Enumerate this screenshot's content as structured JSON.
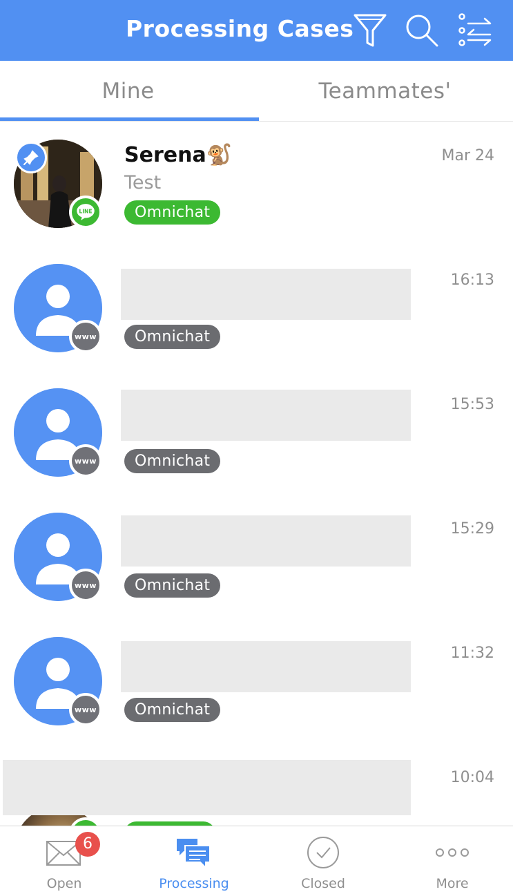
{
  "header": {
    "title": "Processing Cases",
    "icons": [
      "filter-icon",
      "search-icon",
      "sort-icon"
    ],
    "background": "#5190f2"
  },
  "tabs": [
    {
      "label": "Mine",
      "active": true
    },
    {
      "label": "Teammates'",
      "active": false
    }
  ],
  "conversations": [
    {
      "name": "Serena🐒",
      "preview": "Test",
      "time": "Mar 24",
      "tag": "Omnichat",
      "tag_color": "#3cb932",
      "channel": "LINE",
      "pinned": true,
      "avatar": "photo"
    },
    {
      "name": "",
      "preview": "",
      "time": "16:13",
      "tag": "Omnichat",
      "tag_color": "#6b6c70",
      "channel": "www",
      "pinned": false,
      "avatar": "default"
    },
    {
      "name": "",
      "preview": "",
      "time": "15:53",
      "tag": "Omnichat",
      "tag_color": "#6b6c70",
      "channel": "www",
      "pinned": false,
      "avatar": "default"
    },
    {
      "name": "",
      "preview": "",
      "time": "15:29",
      "tag": "Omnichat",
      "tag_color": "#6b6c70",
      "channel": "www",
      "pinned": false,
      "avatar": "default"
    },
    {
      "name": "",
      "preview": "",
      "time": "11:32",
      "tag": "Omnichat",
      "tag_color": "#6b6c70",
      "channel": "www",
      "pinned": false,
      "avatar": "default"
    },
    {
      "name": "",
      "preview": "",
      "time": "10:04",
      "tag": "",
      "tag_color": "#3cb932",
      "channel": "LINE",
      "pinned": false,
      "avatar": "photo"
    }
  ],
  "bottom_nav": [
    {
      "label": "Open",
      "icon": "envelope-icon",
      "badge": "6",
      "active": false
    },
    {
      "label": "Processing",
      "icon": "chat-bubbles-icon",
      "active": true
    },
    {
      "label": "Closed",
      "icon": "check-circle-icon",
      "active": false
    },
    {
      "label": "More",
      "icon": "more-dots-icon",
      "active": false
    }
  ],
  "colors": {
    "accent": "#5190f2",
    "line_green": "#3cb932",
    "badge_red": "#e8504c"
  }
}
